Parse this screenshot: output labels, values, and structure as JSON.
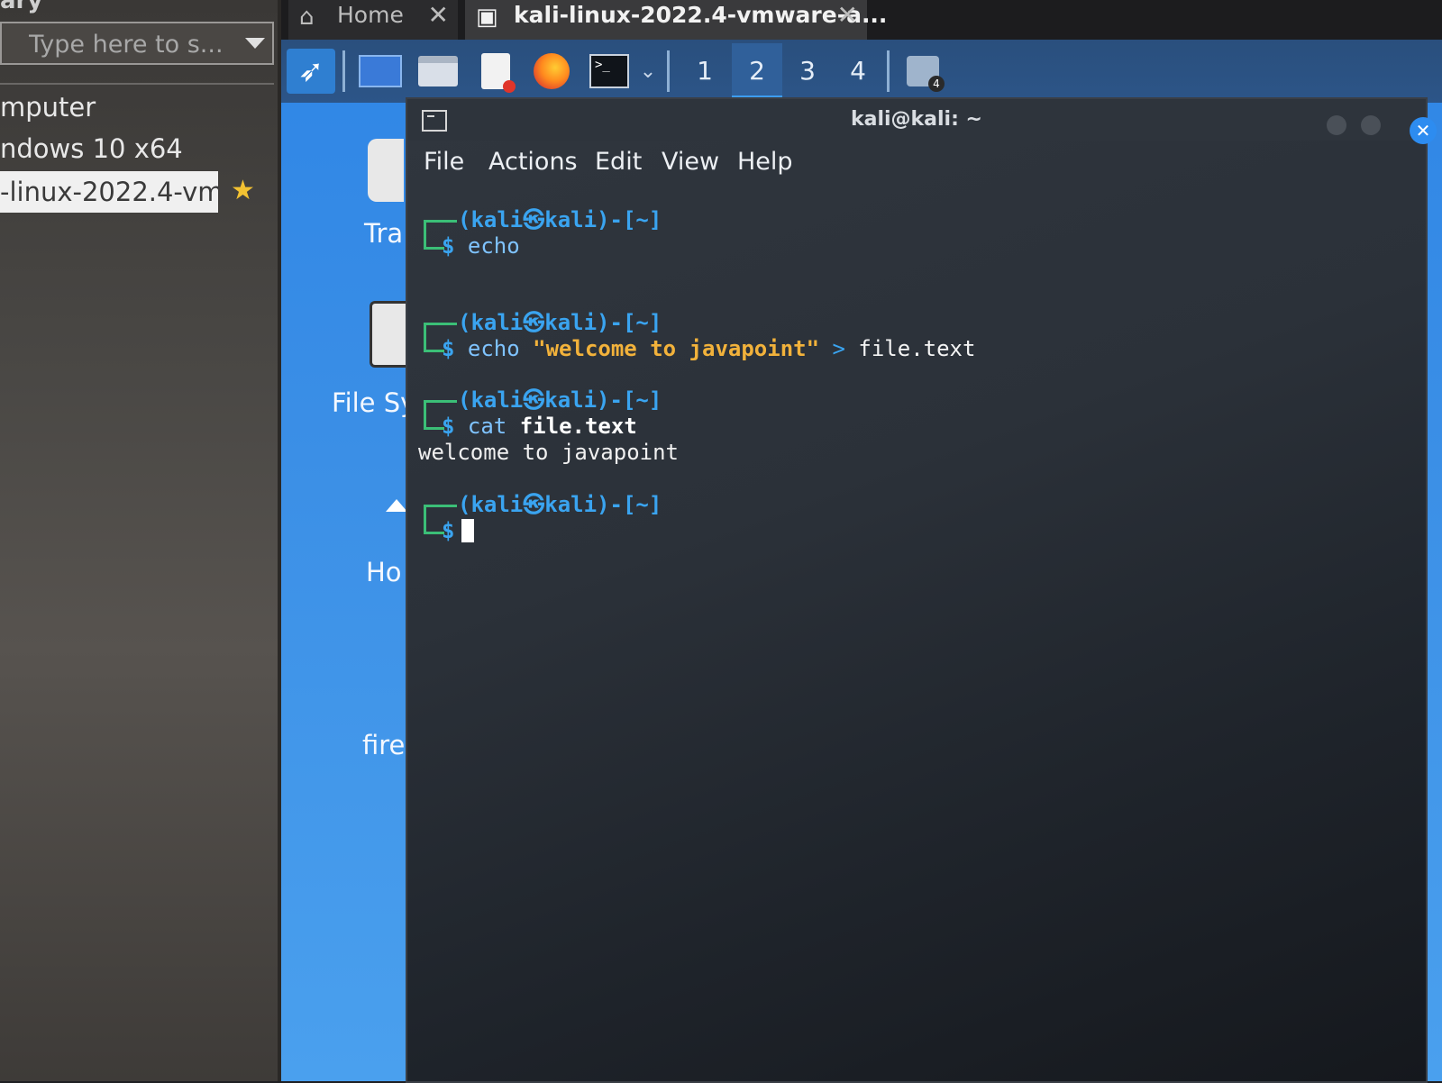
{
  "library": {
    "title": "ary",
    "search_placeholder": "Type here to s...",
    "items": [
      "mputer",
      "ndows 10 x64",
      "-linux-2022.4-vm"
    ]
  },
  "vm_tabs": [
    {
      "label": "Home",
      "icon": "home-icon"
    },
    {
      "label": "kali-linux-2022.4-vmware-a...",
      "icon": "vm-icon"
    }
  ],
  "panel": {
    "workspaces": [
      "1",
      "2",
      "3",
      "4"
    ],
    "active_workspace": "2",
    "workspace_switch_badge": "4"
  },
  "desktop_icons": [
    "Tra",
    "File Sy",
    "Ho",
    "fire"
  ],
  "terminal": {
    "title": "kali@kali: ~",
    "menu": [
      "File",
      "Actions",
      "Edit",
      "View",
      "Help"
    ],
    "prompt": "(kali㉿kali)-[~]",
    "entries": [
      {
        "command": "echo",
        "string": "",
        "redirect": "",
        "target": "",
        "output": ""
      },
      {
        "command": "echo",
        "string": "\"welcome to javapoint\"",
        "redirect": ">",
        "target": "file.text",
        "output": ""
      },
      {
        "command": "cat",
        "string": "",
        "redirect": "",
        "target": "file.text",
        "output": "welcome to javapoint"
      },
      {
        "command": "",
        "string": "",
        "redirect": "",
        "target": "",
        "output": ""
      }
    ]
  },
  "colors": {
    "prompt_blue": "#3aa4f0",
    "bracket_green": "#3bbf77",
    "string_orange": "#f2b23b",
    "desktop_blue": "#2f86e6",
    "close_button": "#2d8cf0"
  }
}
